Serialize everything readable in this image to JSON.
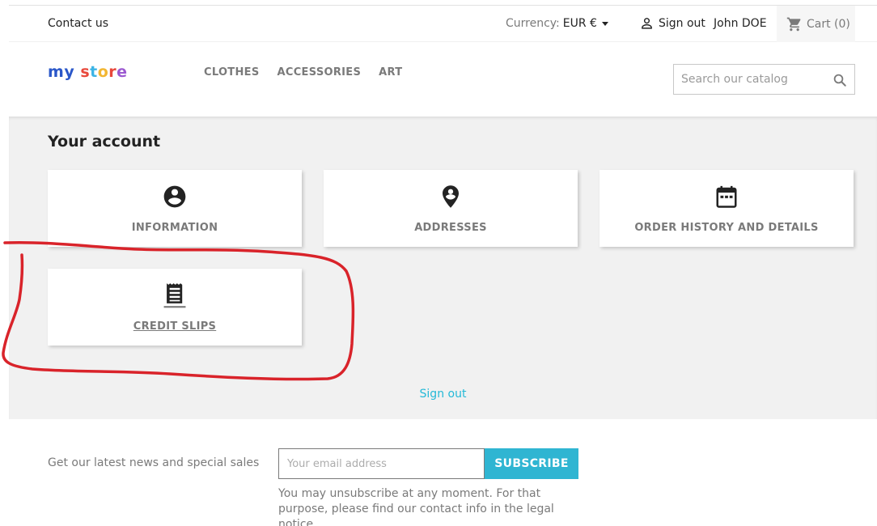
{
  "top_nav": {
    "contact": "Contact us",
    "currency_label": "Currency:",
    "currency_value": "EUR €",
    "sign_out": "Sign out",
    "user_name": "John DOE",
    "cart": "Cart (0)"
  },
  "header": {
    "logo_letters": [
      {
        "char": "m",
        "color": "#2a57c9"
      },
      {
        "char": "y",
        "color": "#2a57c9"
      },
      {
        "char": " ",
        "color": "#2a57c9"
      },
      {
        "char": "s",
        "color": "#e8483b"
      },
      {
        "char": "t",
        "color": "#3cb4e5"
      },
      {
        "char": "o",
        "color": "#f2b632"
      },
      {
        "char": "r",
        "color": "#e8483b"
      },
      {
        "char": "e",
        "color": "#9b59d0"
      }
    ],
    "menu": [
      "CLOTHES",
      "ACCESSORIES",
      "ART"
    ],
    "search_placeholder": "Search our catalog"
  },
  "account": {
    "title": "Your account",
    "cards": [
      {
        "label": "INFORMATION",
        "icon": "account-circle-icon"
      },
      {
        "label": "ADDRESSES",
        "icon": "location-pin-icon"
      },
      {
        "label": "ORDER HISTORY AND DETAILS",
        "icon": "calendar-icon"
      },
      {
        "label": "CREDIT SLIPS",
        "icon": "receipt-icon"
      }
    ],
    "sign_out": "Sign out"
  },
  "newsletter": {
    "text": "Get our latest news and special sales",
    "email_placeholder": "Your email address",
    "subscribe": "SUBSCRIBE",
    "note": "You may unsubscribe at any moment. For that purpose, please find our contact info in the legal notice."
  },
  "colors": {
    "accent": "#2fb5d2",
    "link": "#24b9d7",
    "annotation": "#d9232a",
    "section_bg": "#f1f1f1"
  }
}
